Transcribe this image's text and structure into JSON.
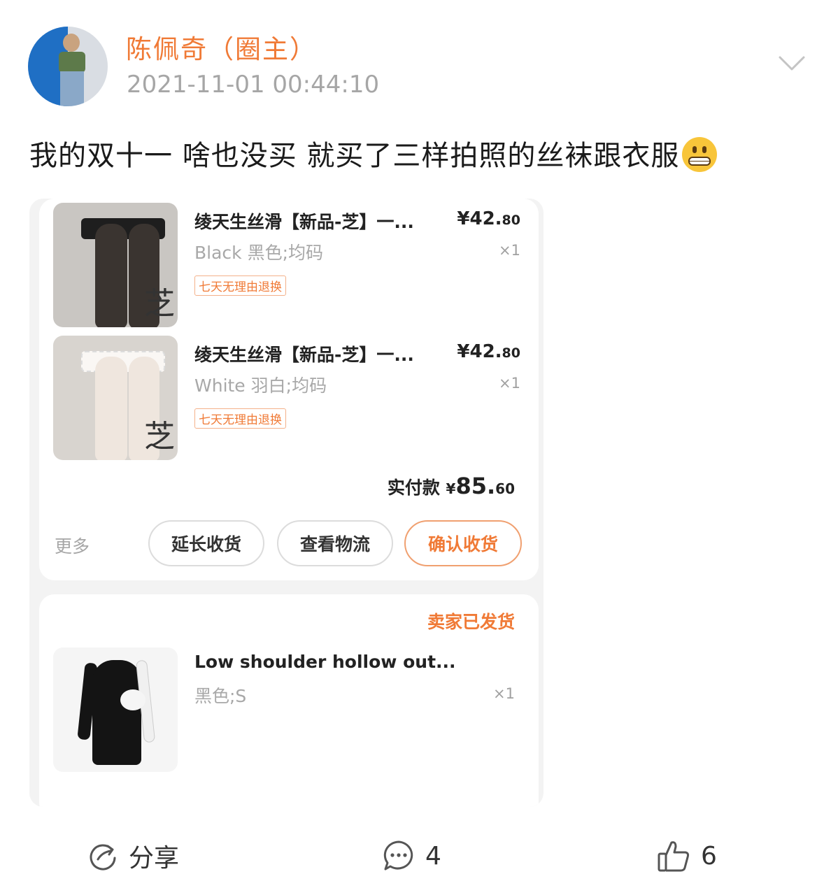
{
  "post": {
    "author": "陈佩奇（圈主）",
    "timestamp": "2021-11-01 00:44:10",
    "text": "我的双十一 啥也没买 就买了三样拍照的丝袜跟衣服",
    "emoji": "grimacing-face"
  },
  "order": {
    "items": [
      {
        "title": "绫天生丝滑【新品-芝】一...",
        "price_main": "¥42.",
        "price_dec": "80",
        "spec": "Black 黑色;均码",
        "qty": "×1",
        "tag": "七天无理由退换",
        "thumb_mark": "芝"
      },
      {
        "title": "绫天生丝滑【新品-芝】一...",
        "price_main": "¥42.",
        "price_dec": "80",
        "spec": "White 羽白;均码",
        "qty": "×1",
        "tag": "七天无理由退换",
        "thumb_mark": "芝"
      }
    ],
    "paid_label": "实付款",
    "paid_currency": "¥",
    "paid_main": "85.",
    "paid_dec": "60",
    "more": "更多",
    "buttons": {
      "extend": "延长收货",
      "logistics": "查看物流",
      "confirm": "确认收货"
    }
  },
  "order2": {
    "status": "卖家已发货",
    "title": "Low shoulder hollow out...",
    "spec": "黑色;S",
    "qty": "×1"
  },
  "actions": {
    "share": "分享",
    "comments": "4",
    "likes": "6"
  },
  "colors": {
    "accent": "#f07a36",
    "muted": "#a6a6a6"
  }
}
